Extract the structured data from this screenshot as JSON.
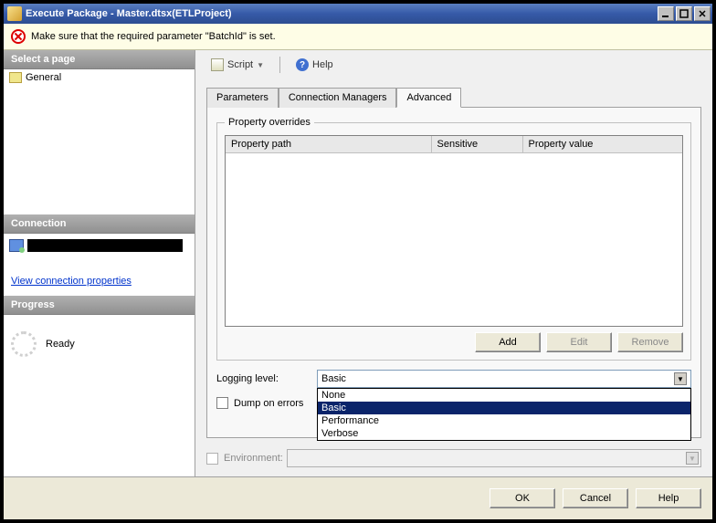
{
  "window": {
    "title": "Execute Package - Master.dtsx(ETLProject)"
  },
  "warning": {
    "text": "Make sure that the required parameter \"BatchId\" is set."
  },
  "sidebar": {
    "selectpage_header": "Select a page",
    "general_label": "General",
    "connection_header": "Connection",
    "view_link": "View connection properties",
    "progress_header": "Progress",
    "ready_label": "Ready"
  },
  "toolbar": {
    "script_label": "Script",
    "help_label": "Help"
  },
  "tabs": {
    "parameters": "Parameters",
    "connection_managers": "Connection Managers",
    "advanced": "Advanced"
  },
  "advanced": {
    "group_title": "Property overrides",
    "columns": {
      "path": "Property path",
      "sensitive": "Sensitive",
      "value": "Property value"
    },
    "buttons": {
      "add": "Add",
      "edit": "Edit",
      "remove": "Remove"
    },
    "logging_label": "Logging level:",
    "logging_value": "Basic",
    "logging_options": [
      "None",
      "Basic",
      "Performance",
      "Verbose"
    ],
    "dump_label": "Dump on errors"
  },
  "environment_label": "Environment:",
  "footer": {
    "ok": "OK",
    "cancel": "Cancel",
    "help": "Help"
  }
}
